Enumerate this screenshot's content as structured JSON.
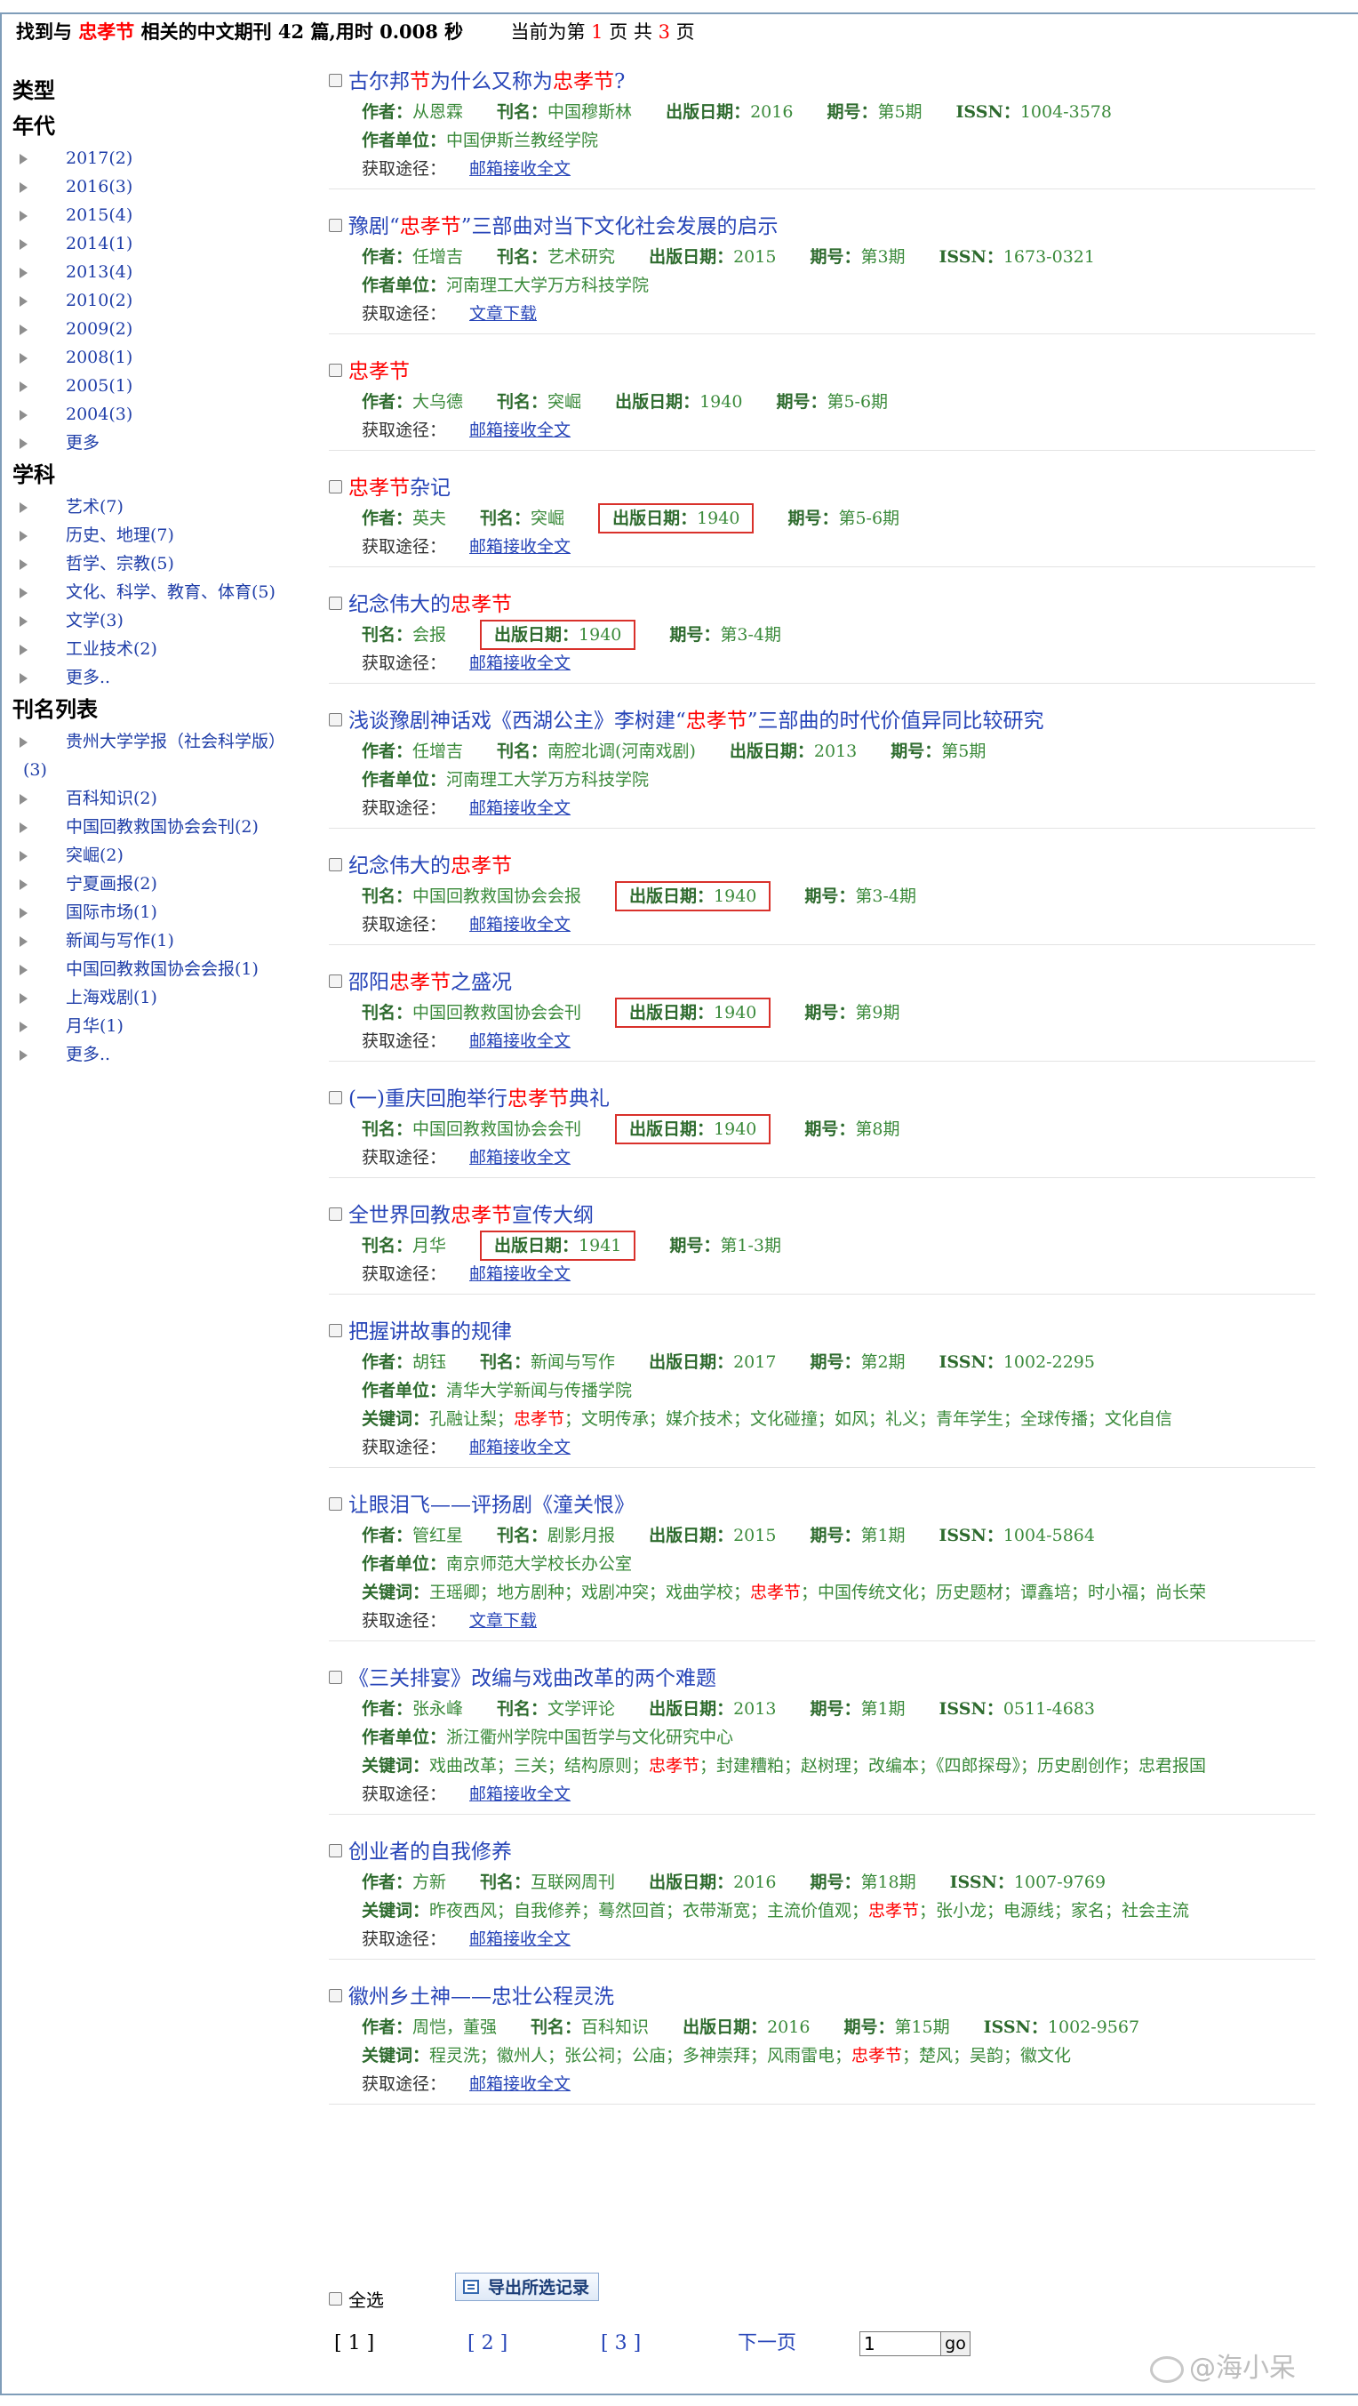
{
  "summary": {
    "found_prefix": "找到与",
    "keyword": "忠孝节",
    "found_suffix": "相关的中文期刊 42 篇,用时 0.008 秒",
    "page_prefix": "当前为第",
    "current_page": "1",
    "page_mid": "页 共",
    "total_pages": "3",
    "page_suffix": "页"
  },
  "sidebar": {
    "type_heading": "类型",
    "year_heading": "年代",
    "years": [
      "2017(2)",
      "2016(3)",
      "2015(4)",
      "2014(1)",
      "2013(4)",
      "2010(2)",
      "2009(2)",
      "2008(1)",
      "2005(1)",
      "2004(3)"
    ],
    "year_more": "更多",
    "subject_heading": "学科",
    "subjects": [
      "艺术(7)",
      "历史、地理(7)",
      "哲学、宗教(5)",
      "文化、科学、教育、体育(5)",
      "文学(3)",
      "工业技术(2)"
    ],
    "subject_more": "更多..",
    "journal_heading": "刊名列表",
    "journal_first_line": "贵州大学学报（社会科学版）",
    "journal_first_count": "(3)",
    "journals": [
      "百科知识(2)",
      "中国回教救国协会会刊(2)",
      "突崛(2)",
      "宁夏画报(2)",
      "国际市场(1)",
      "新闻与写作(1)",
      "中国回教救国协会会报(1)",
      "上海戏剧(1)",
      "月华(1)"
    ],
    "journal_more": "更多.."
  },
  "labels": {
    "author": "作者：",
    "journal": "刊名：",
    "date": "出版日期：",
    "issue": "期号：",
    "issn": "ISSN：",
    "org": "作者单位：",
    "keywords": "关键词：",
    "access": "获取途径："
  },
  "records": [
    {
      "title_pre": "古尔邦",
      "title_hl": "节",
      "title_mid": "为什么又称为",
      "title_hl2": "忠孝节",
      "title_post": "?",
      "author": "从恩霖",
      "journal": "中国穆斯林",
      "date": "2016",
      "issue": "第5期",
      "issn": "1004-3578",
      "org": "中国伊斯兰教经学院",
      "access": "邮箱接收全文"
    },
    {
      "title_pre": "豫剧“",
      "title_hl": "忠孝节",
      "title_post": "”三部曲对当下文化社会发展的启示",
      "author": "任增吉",
      "journal": "艺术研究",
      "date": "2015",
      "issue": "第3期",
      "issn": "1673-0321",
      "org": "河南理工大学万方科技学院",
      "access": "文章下载"
    },
    {
      "title_pre": "",
      "title_hl": "忠孝节",
      "title_post": "",
      "author": "大乌德",
      "journal": "突崛",
      "date": "1940",
      "issue": "第5-6期",
      "access": "邮箱接收全文"
    },
    {
      "title_pre": "",
      "title_hl": "忠孝节",
      "title_post": "杂记",
      "author": "英夫",
      "journal": "突崛",
      "date": "1940",
      "issue": "第5-6期",
      "access": "邮箱接收全文"
    },
    {
      "title_pre": "纪念伟大的",
      "title_hl": "忠孝节",
      "title_post": "",
      "journal": "会报",
      "date": "1940",
      "issue": "第3-4期",
      "access": "邮箱接收全文"
    },
    {
      "title_pre": "浅谈豫剧神话戏《西湖公主》李树建“",
      "title_hl": "忠孝节",
      "title_post": "”三部曲的时代价值异同比较研究",
      "author": "任增吉",
      "journal": "南腔北调(河南戏剧)",
      "date": "2013",
      "issue": "第5期",
      "org": "河南理工大学万方科技学院",
      "access": "邮箱接收全文"
    },
    {
      "title_pre": "纪念伟大的",
      "title_hl": "忠孝节",
      "title_post": "",
      "journal": "中国回教救国协会会报",
      "date": "1940",
      "issue": "第3-4期",
      "access": "邮箱接收全文"
    },
    {
      "title_pre": "邵阳",
      "title_hl": "忠孝节",
      "title_post": "之盛况",
      "journal": "中国回教救国协会会刊",
      "date": "1940",
      "issue": "第9期",
      "access": "邮箱接收全文"
    },
    {
      "title_pre": "(一)重庆回胞举行",
      "title_hl": "忠孝节",
      "title_post": "典礼",
      "journal": "中国回教救国协会会刊",
      "date": "1940",
      "issue": "第8期",
      "access": "邮箱接收全文"
    },
    {
      "title_pre": "全世界回教",
      "title_hl": "忠孝节",
      "title_post": "宣传大纲",
      "journal": "月华",
      "date": "1941",
      "issue": "第1-3期",
      "access": "邮箱接收全文"
    },
    {
      "title_pre": "把握讲故事的规律",
      "title_hl": "",
      "title_post": "",
      "author": "胡钰",
      "journal": "新闻与写作",
      "date": "2017",
      "issue": "第2期",
      "issn": "1002-2295",
      "org": "清华大学新闻与传播学院",
      "kw_pre": "孔融让梨；",
      "kw_hl": "忠孝节",
      "kw_post": "；文明传承；媒介技术；文化碰撞；如风；礼义；青年学生；全球传播；文化自信",
      "access": "邮箱接收全文"
    },
    {
      "title_pre": "让眼泪飞——评扬剧《潼关恨》",
      "title_hl": "",
      "title_post": "",
      "author": "管红星",
      "journal": "剧影月报",
      "date": "2015",
      "issue": "第1期",
      "issn": "1004-5864",
      "org": "南京师范大学校长办公室",
      "kw_pre": "王瑶卿；地方剧种；戏剧冲突；戏曲学校；",
      "kw_hl": "忠孝节",
      "kw_post": "；中国传统文化；历史题材；谭鑫培；时小福；尚长荣",
      "access": "文章下载"
    },
    {
      "title_pre": "《三关排宴》改编与戏曲改革的两个难题",
      "title_hl": "",
      "title_post": "",
      "author": "张永峰",
      "journal": "文学评论",
      "date": "2013",
      "issue": "第1期",
      "issn": "0511-4683",
      "org": "浙江衢州学院中国哲学与文化研究中心",
      "kw_pre": "戏曲改革；三关；结构原则；",
      "kw_hl": "忠孝节",
      "kw_post": "；封建糟粕；赵树理；改编本；《四郎探母》；历史剧创作；忠君报国",
      "access": "邮箱接收全文"
    },
    {
      "title_pre": "创业者的自我修养",
      "title_hl": "",
      "title_post": "",
      "author": "方新",
      "journal": "互联网周刊",
      "date": "2016",
      "issue": "第18期",
      "issn": "1007-9769",
      "kw_pre": "昨夜西风；自我修养；蓦然回首；衣带渐宽；主流价值观；",
      "kw_hl": "忠孝节",
      "kw_post": "；张小龙；电源线；家名；社会主流",
      "access": "邮箱接收全文"
    },
    {
      "title_pre": "徽州乡土神——忠壮公程灵洗",
      "title_hl": "",
      "title_post": "",
      "author": "周恺，董强",
      "journal": "百科知识",
      "date": "2016",
      "issue": "第15期",
      "issn": "1002-9567",
      "kw_pre": "程灵洗；徽州人；张公祠；公庙；多神崇拜；风雨雷电；",
      "kw_hl": "忠孝节",
      "kw_post": "；楚风；吴韵；徽文化",
      "access": "邮箱接收全文"
    }
  ],
  "footer": {
    "select_all": "全选",
    "export_label": "导出所选记录",
    "page_current": "[ 1 ]",
    "page_2": "[ 2 ]",
    "page_3": "[ 3 ]",
    "next_page": "下一页",
    "goto_value": "1",
    "go_label": "go"
  },
  "watermark": "@海小呆",
  "colors": {
    "highlight": "#ff0000",
    "link": "#2745b8",
    "meta": "#3a8a3a",
    "box": "#d9312b"
  }
}
